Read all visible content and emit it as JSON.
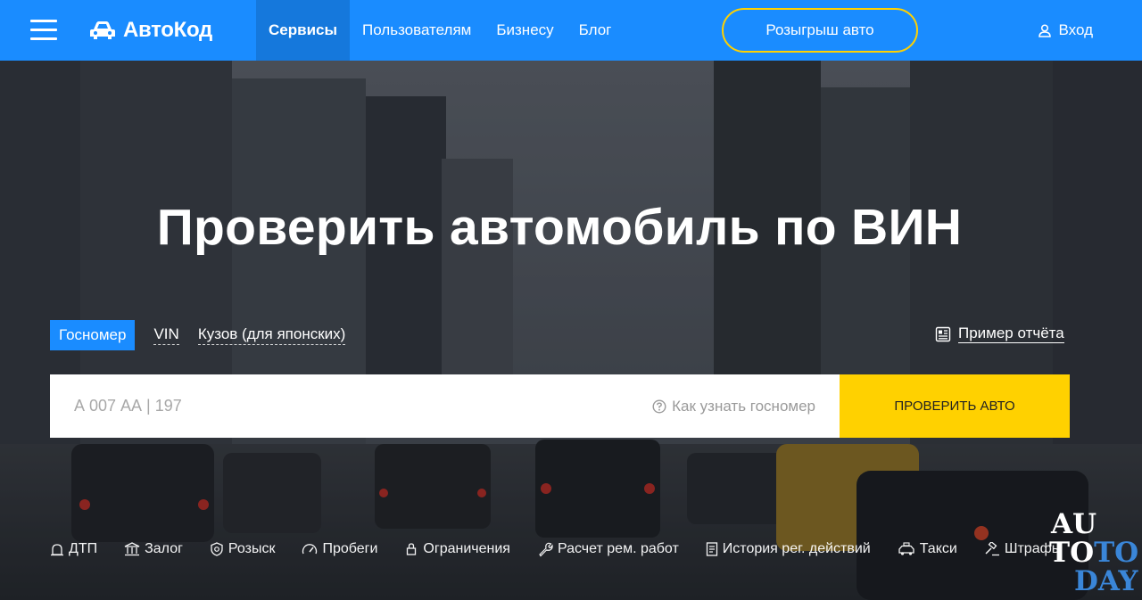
{
  "header": {
    "logo": "АвтоКод",
    "nav": [
      "Сервисы",
      "Пользователям",
      "Бизнесу",
      "Блог"
    ],
    "promo": "Розыгрыш авто",
    "login": "Вход"
  },
  "hero": {
    "title": "Проверить автомобиль по ВИН",
    "tabs": [
      "Госномер",
      "VIN",
      "Кузов (для японских)"
    ],
    "sample_report": "Пример отчёта",
    "search": {
      "placeholder": "А 007 АА | 197",
      "help": "Как узнать госномер",
      "button": "ПРОВЕРИТЬ АВТО"
    }
  },
  "services": [
    {
      "label": "ДТП",
      "icon": "accident-icon"
    },
    {
      "label": "Залог",
      "icon": "bank-icon"
    },
    {
      "label": "Розыск",
      "icon": "police-badge-icon"
    },
    {
      "label": "Пробеги",
      "icon": "speedometer-icon"
    },
    {
      "label": "Ограничения",
      "icon": "lock-icon"
    },
    {
      "label": "Расчет рем. работ",
      "icon": "wrench-icon"
    },
    {
      "label": "История рег. действий",
      "icon": "document-icon"
    },
    {
      "label": "Такси",
      "icon": "taxi-icon"
    },
    {
      "label": "Штрафы",
      "icon": "gavel-icon"
    }
  ],
  "watermark": {
    "line1": "AU",
    "line2a": "TO",
    "line2b": "TO",
    "line3": "DAY"
  },
  "colors": {
    "brand_blue": "#1a8cff",
    "accent_yellow": "#ffd100"
  }
}
